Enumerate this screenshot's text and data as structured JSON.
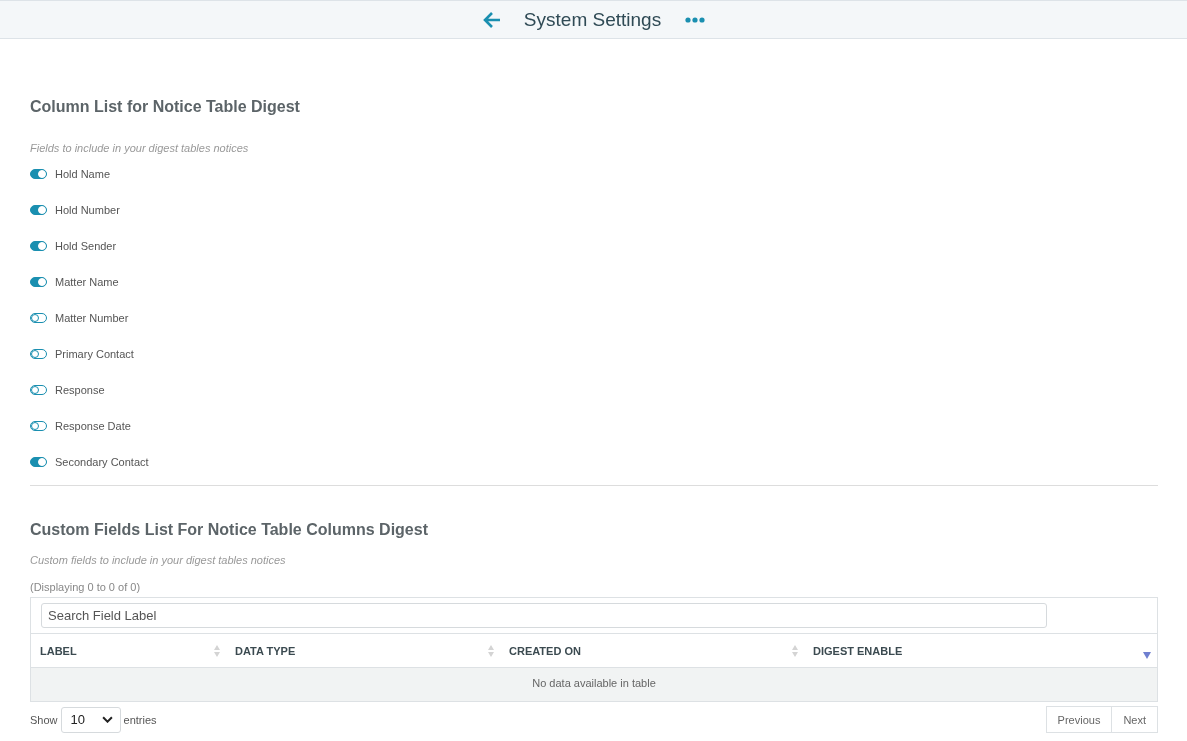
{
  "header": {
    "title": "System Settings"
  },
  "column_list": {
    "title": "Column List for Notice Table Digest",
    "hint": "Fields to include in your digest tables notices",
    "fields": [
      {
        "label": "Hold Name",
        "on": true
      },
      {
        "label": "Hold Number",
        "on": true
      },
      {
        "label": "Hold Sender",
        "on": true
      },
      {
        "label": "Matter Name",
        "on": true
      },
      {
        "label": "Matter Number",
        "on": false
      },
      {
        "label": "Primary Contact",
        "on": false
      },
      {
        "label": "Response",
        "on": false
      },
      {
        "label": "Response Date",
        "on": false
      },
      {
        "label": "Secondary Contact",
        "on": true
      }
    ]
  },
  "custom_fields": {
    "title": "Custom Fields List For Notice Table Columns Digest",
    "hint": "Custom fields to include in your digest tables notices",
    "count": "(Displaying 0 to 0 of 0)",
    "search": {
      "placeholder": "Search Field Label"
    },
    "table": {
      "columns": [
        {
          "label": "LABEL",
          "sorted": false
        },
        {
          "label": "DATA TYPE",
          "sorted": false
        },
        {
          "label": "CREATED ON",
          "sorted": false
        },
        {
          "label": "DIGEST ENABLE",
          "sorted": true
        }
      ],
      "empty": "No data available in table"
    },
    "length": {
      "before": "Show",
      "value": "10",
      "after": "entries"
    },
    "pager": [
      "Previous",
      "Next"
    ]
  }
}
